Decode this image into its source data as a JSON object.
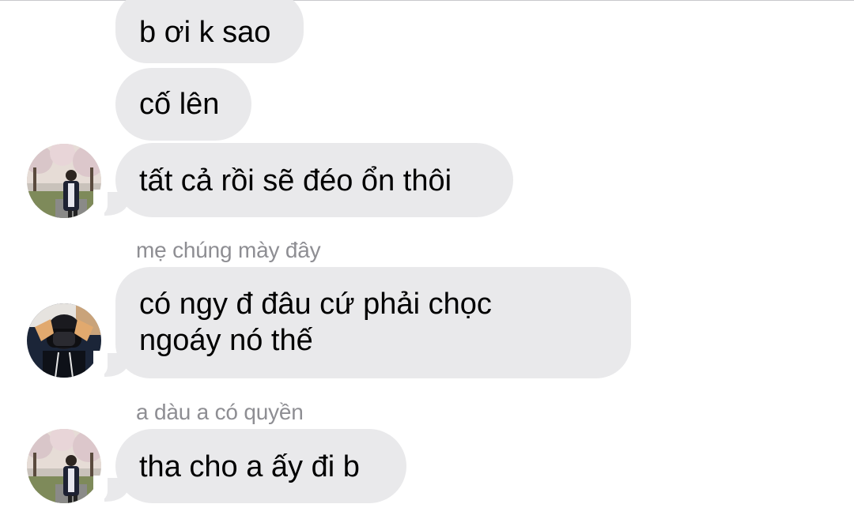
{
  "conversation": {
    "messages": [
      {
        "text": "b ơi k sao"
      },
      {
        "text": "cố lên"
      },
      {
        "text": "tất cả rồi sẽ đéo ổn thôi"
      },
      {
        "sender": "mẹ chúng mày đây",
        "text": "có ngy đ đâu cứ phải chọc ngoáy nó thế"
      },
      {
        "sender": "a dàu a có quyền",
        "text": "tha cho a ấy đi b"
      }
    ]
  },
  "colors": {
    "bubble_background": "#e9e9eb",
    "sender_name": "#8e8e93",
    "text": "#000000"
  },
  "icons": {
    "avatar_1": "photo-avatar-person-blossom-trees",
    "avatar_2": "photo-avatar-person-masked",
    "avatar_3": "photo-avatar-person-blossom-trees"
  }
}
